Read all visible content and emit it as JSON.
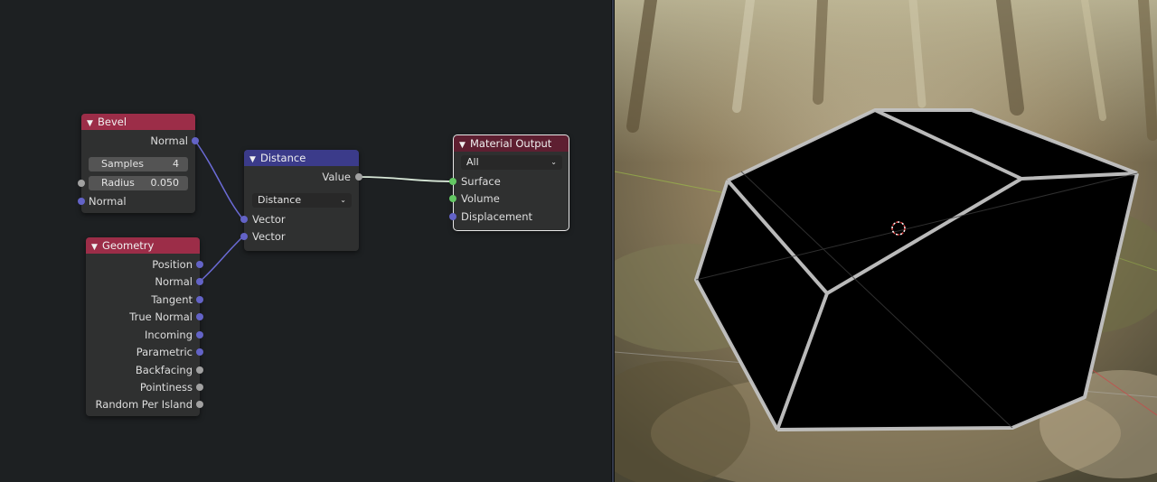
{
  "nodes": {
    "bevel": {
      "title": "Bevel",
      "outputs": [
        "Normal"
      ],
      "samples": {
        "label": "Samples",
        "value": "4"
      },
      "radius": {
        "label": "Radius",
        "value": "0.050"
      },
      "inputs": [
        "Normal"
      ]
    },
    "geometry": {
      "title": "Geometry",
      "outputs": [
        "Position",
        "Normal",
        "Tangent",
        "True Normal",
        "Incoming",
        "Parametric",
        "Backfacing",
        "Pointiness",
        "Random Per Island"
      ]
    },
    "distance": {
      "title": "Distance",
      "output": "Value",
      "operation": "Distance",
      "inputs": [
        "Vector",
        "Vector"
      ]
    },
    "material_output": {
      "title": "Material Output",
      "target": "All",
      "inputs": [
        "Surface",
        "Volume",
        "Displacement"
      ]
    }
  },
  "colors": {
    "editor_bg": "#1d2022",
    "node_body": "#2f3030",
    "header_texture": "#9c2d48",
    "header_vector": "#3b3b8a",
    "header_output": "#5e1f31",
    "socket_vector": "#6363c7",
    "socket_float": "#a1a1a1",
    "socket_shader": "#63c763",
    "link_vector": "#6b6bd6",
    "link_float": "#d8e8d8"
  },
  "icons": {
    "collapse": "chevron-down-icon",
    "dropdown": "chevron-down-icon",
    "cursor": "3d-cursor-icon"
  }
}
